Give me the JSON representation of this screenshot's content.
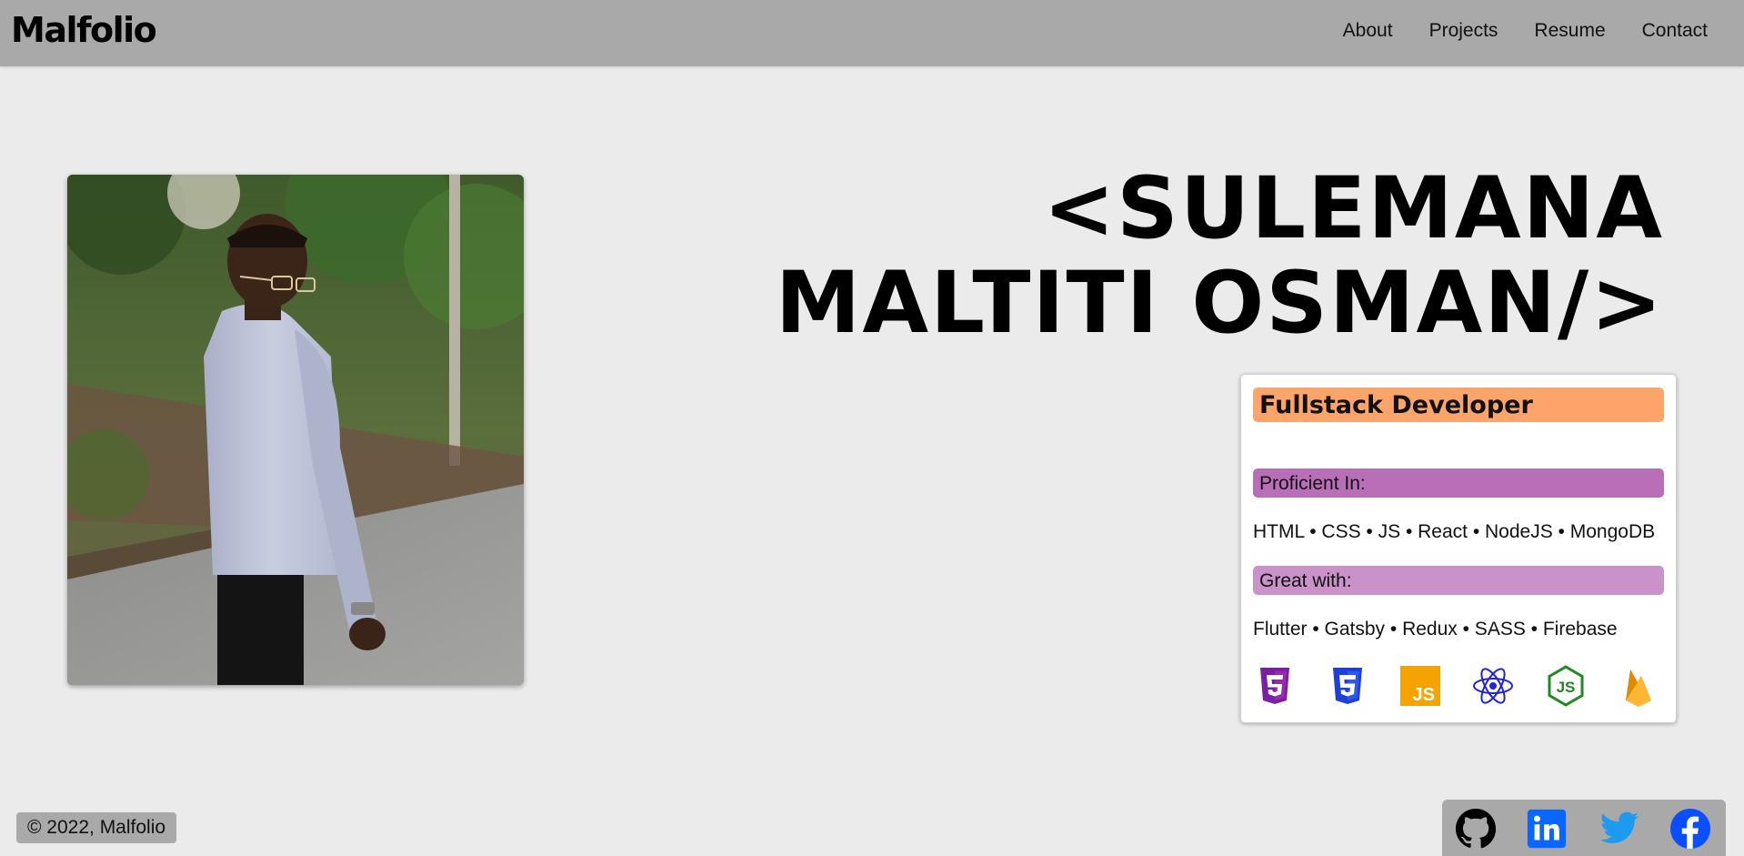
{
  "navbar": {
    "logo": "Malfolio",
    "links": [
      "About",
      "Projects",
      "Resume",
      "Contact"
    ]
  },
  "hero": {
    "name_line1": "<SULEMANA",
    "name_line2": "MALTITI OSMAN/>"
  },
  "card": {
    "role": "Fullstack Developer",
    "proficient_label": "Proficient In:",
    "proficient_skills": "HTML • CSS • JS • React • NodeJS • MongoDB",
    "great_label": "Great with:",
    "great_skills": "Flutter • Gatsby • Redux • SASS • Firebase",
    "tech_icons": [
      "html5-icon",
      "css3-icon",
      "javascript-icon",
      "react-icon",
      "nodejs-icon",
      "firebase-icon"
    ]
  },
  "footer": {
    "copyright": "© 2022, Malfolio",
    "social_icons": [
      "github-icon",
      "linkedin-icon",
      "twitter-icon",
      "facebook-icon"
    ]
  },
  "colors": {
    "navbar_bg": "#a9a9a9",
    "page_bg": "#ebebeb",
    "role_band": "#fca46a",
    "proficient_band": "#b86fb8",
    "great_band": "#c992c9",
    "html5": "#7b1fa2",
    "css3": "#1e40d8",
    "javascript": "#f5a300",
    "react": "#2323d8",
    "nodejs": "#1f8a1f",
    "firebase": "#f5a300",
    "github": "#000000",
    "linkedin": "#0a66ff",
    "twitter": "#1d9bf0",
    "facebook": "#0a4fff"
  }
}
